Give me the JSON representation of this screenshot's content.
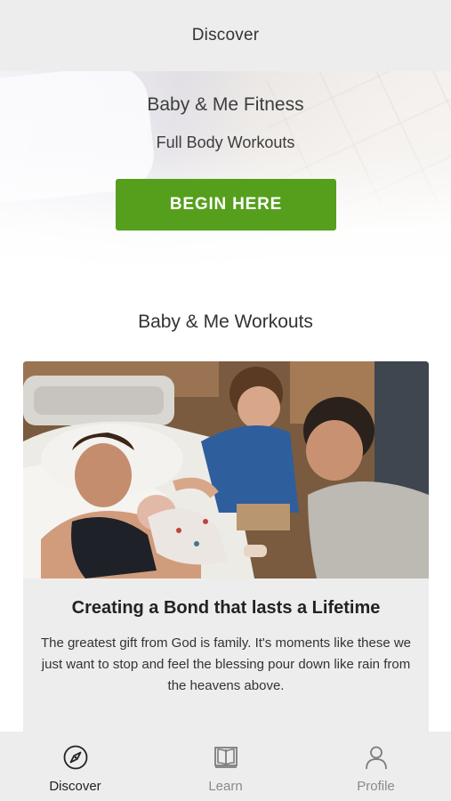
{
  "header": {
    "title": "Discover"
  },
  "hero": {
    "title": "Baby & Me Fitness",
    "subtitle": "Full Body Workouts",
    "cta_label": "BEGIN HERE",
    "cta_color": "#559f1d"
  },
  "section": {
    "title": "Baby & Me Workouts"
  },
  "card": {
    "image_icon": "family-photo",
    "title": "Creating a Bond that lasts a Lifetime",
    "text": "The greatest gift from God is family.  It's moments like these we just want to stop and feel the blessing pour down like rain from the heavens above."
  },
  "tabbar": {
    "items": [
      {
        "label": "Discover",
        "icon": "compass-icon",
        "active": true
      },
      {
        "label": "Learn",
        "icon": "book-icon",
        "active": false
      },
      {
        "label": "Profile",
        "icon": "person-icon",
        "active": false
      }
    ]
  }
}
